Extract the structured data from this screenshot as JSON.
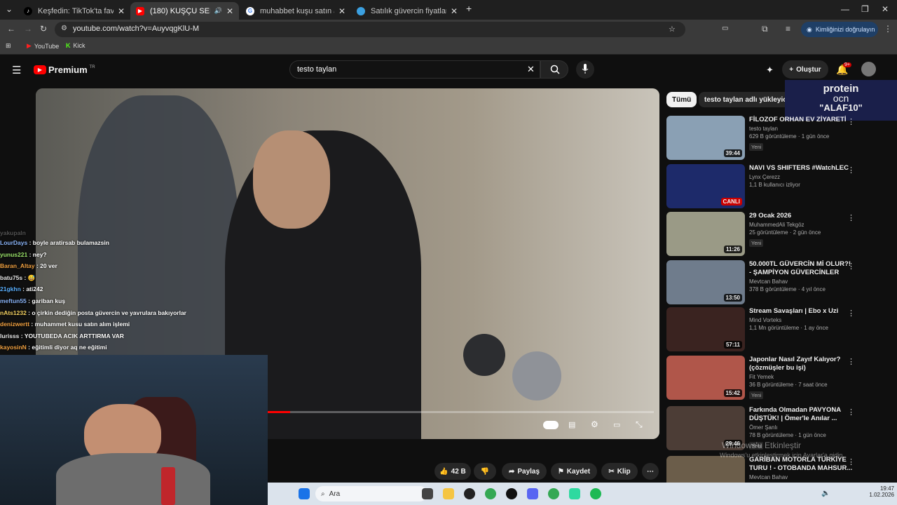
{
  "browser": {
    "tabs": [
      {
        "title": "Keşfedin: TikTok'ta favori video",
        "icon": "tiktok-icon"
      },
      {
        "title": "(180) KUŞÇU SERCAN TOP",
        "icon": "youtube-icon"
      },
      {
        "title": "muhabbet kuşu satın al - Goog",
        "icon": "google-icon"
      },
      {
        "title": "Satılık güvercin fiyatları ve çeşit",
        "icon": "site-icon"
      }
    ],
    "url": "youtube.com/watch?v=AuyvqgKlU-M",
    "verify_label": "Kimliğinizi doğrulayın",
    "bookmarks": [
      "YouTube",
      "Kick"
    ]
  },
  "youtube": {
    "logo": "Premium",
    "region": "TR",
    "search_value": "testo taylan",
    "create_label": "Oluştur",
    "notif_count": "9+",
    "chips": [
      "Tümü",
      "testo taylan adlı yükleyicide"
    ],
    "actions": {
      "like_count": "42 B",
      "share": "Paylaş",
      "save": "Kaydet",
      "clip": "Klip"
    },
    "video_progress": 0.06
  },
  "recommendations": [
    {
      "title": "FİLOZOF ORHAN EV ZİYARETİ",
      "channel": "testo taylan",
      "meta": "629 B görüntüleme · 1 gün önce",
      "badge": "Yeni",
      "duration": "39:44",
      "thumb": "#8aa0b4"
    },
    {
      "title": "NAVI VS SHIFTERS  #WatchLEC",
      "channel": "Lynx Çerezz",
      "meta": "1,1 B kullanıcı izliyor",
      "badge": "",
      "duration": "CANLI",
      "thumb": "#1d2a6a"
    },
    {
      "title": "29 Ocak 2026",
      "channel": "MuhammedAli Tekgöz",
      "meta": "25 görüntüleme · 2 gün önce",
      "badge": "Yeni",
      "duration": "11:26",
      "thumb": "#9a9a86"
    },
    {
      "title": "50.000TL GÜVERCİN Mİ OLUR?! - ŞAMPİYON GÜVERCİNLER",
      "channel": "Mevtcan Bahav",
      "meta": "378 B görüntüleme · 4 yıl önce",
      "badge": "",
      "duration": "13:50",
      "thumb": "#6f7c8c"
    },
    {
      "title": "Stream Savaşları | Ebo x Uzi",
      "channel": "Mind Vorteks",
      "meta": "1,1 Mn görüntüleme · 1 ay önce",
      "badge": "",
      "duration": "57:11",
      "thumb": "#3a2320"
    },
    {
      "title": "Japonlar Nasıl Zayıf Kalıyor? (çözmüşler bu işi)",
      "channel": "Fit Yemek",
      "meta": "36 B görüntüleme · 7 saat önce",
      "badge": "Yeni",
      "duration": "15:42",
      "thumb": "#b0564a"
    },
    {
      "title": "Farkında Olmadan PAVYONA DÜŞTÜK! | Ömer'le Anılar ...",
      "channel": "Ömer Şanlı",
      "meta": "78 B görüntüleme · 1 gün önce",
      "badge": "Yeni",
      "duration": "29:46",
      "thumb": "#4c3d36"
    },
    {
      "title": "GARİBAN MOTORLA TÜRKİYE TURU ! - OTOBANDA MAHSUR...",
      "channel": "Mevtcan Bahav",
      "meta": "",
      "badge": "",
      "duration": "",
      "thumb": "#6b5d4a"
    }
  ],
  "ad": {
    "line1": "protein",
    "line2": "ocn",
    "line3": "\"ALAF10\""
  },
  "chat": [
    {
      "user": "LourDays",
      "color": "#8ab4f8",
      "msg": "boyle aratirsab bulamazsin"
    },
    {
      "user": "yunus221",
      "color": "#9be36a",
      "msg": "ney?"
    },
    {
      "user": "Baran_Altay",
      "color": "#f0a040",
      "msg": "20 ver"
    },
    {
      "user": "batu75s",
      "color": "#e8e8e8",
      "msg": "😅"
    },
    {
      "user": "21gkhn",
      "color": "#5ab0ff",
      "msg": "ati242"
    },
    {
      "user": "meftun55",
      "color": "#8ab4f8",
      "msg": "gariban kuş"
    },
    {
      "user": "nAts1232",
      "color": "#f3d060",
      "msg": "o çirkin dediğin posta güvercin ve yavrulara bakıyorlar"
    },
    {
      "user": "denizwertt",
      "color": "#f0a040",
      "msg": "muhammet kusu satın alım işlemi"
    },
    {
      "user": "lurisss",
      "color": "#e8e8e8",
      "msg": "YOUTUBEDA ACIK ARTTIRMA VAR"
    },
    {
      "user": "kayosinN",
      "color": "#f0a040",
      "msg": "eğitimli diyor aq ne eğitimi"
    }
  ],
  "chat_faded_first": "yakupaln",
  "watermark": {
    "line1": "Windows'u Etkinleştir",
    "line2": "Windows'u etkinleştirmek için Ayarlar'a gidin."
  },
  "taskbar": {
    "search": "Ara",
    "time": "19:47",
    "date": "1.02.2026"
  }
}
